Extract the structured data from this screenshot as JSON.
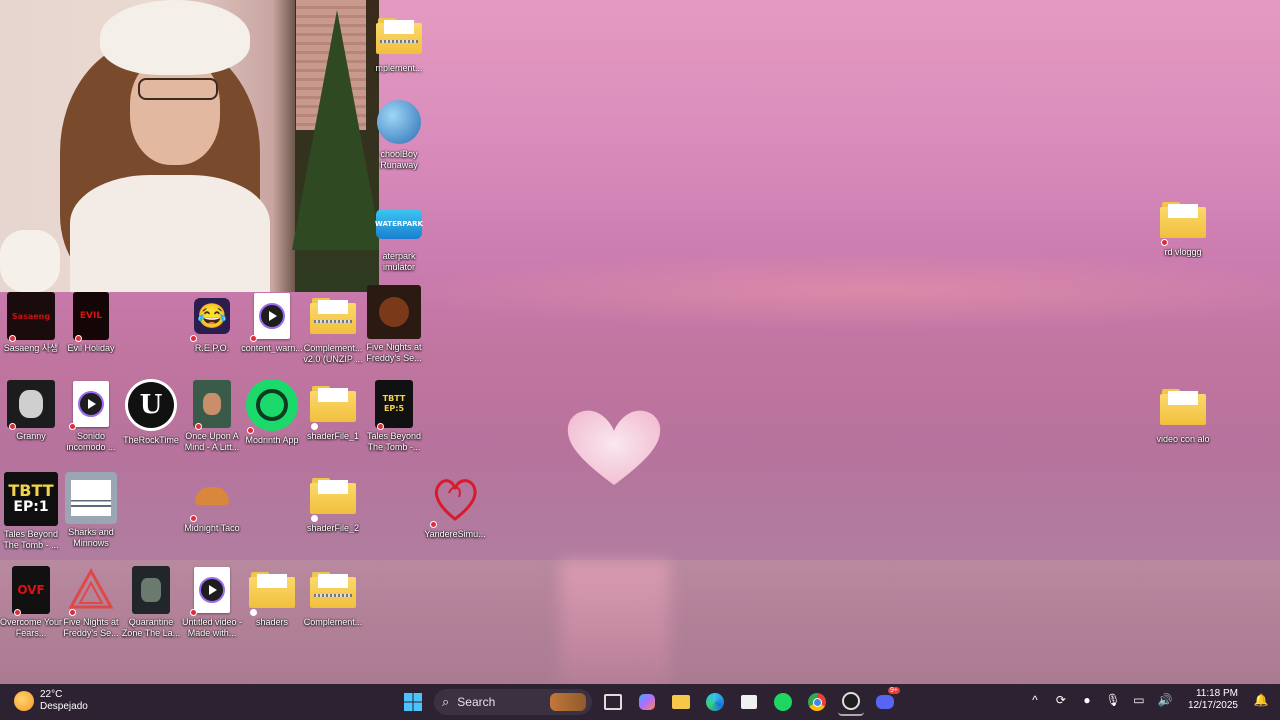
{
  "desktop": {
    "icons": [
      {
        "id": "complement-top",
        "label": "mplement..."
      },
      {
        "id": "schoolboy",
        "label": "choolBoy Runaway"
      },
      {
        "id": "waterpark",
        "label": "aterpark imulator"
      },
      {
        "id": "rd-vloggg",
        "label": "rd vloggg"
      },
      {
        "id": "video-con-alo",
        "label": "video con alo"
      },
      {
        "id": "sasaeng",
        "label": "Sasaeng 사생"
      },
      {
        "id": "evil-holiday",
        "label": "Evil Holiday"
      },
      {
        "id": "repo",
        "label": "R.E.P.O."
      },
      {
        "id": "content-warn",
        "label": "content_warn..."
      },
      {
        "id": "complement-v2",
        "label": "Complement... v2.0 (UNZIP ..."
      },
      {
        "id": "fnaf-se-1",
        "label": "Five Nights at Freddy's Se..."
      },
      {
        "id": "granny",
        "label": "Granny"
      },
      {
        "id": "sonido",
        "label": "Sonido incomodo ..."
      },
      {
        "id": "therocktime",
        "label": "TheRockTime"
      },
      {
        "id": "once-upon",
        "label": "Once Upon A Mind - A Litt..."
      },
      {
        "id": "modrinth",
        "label": "Modrinth App"
      },
      {
        "id": "shaderfile-1",
        "label": "shaderFile_1"
      },
      {
        "id": "tales-tomb-1",
        "label": "Tales Beyond The Tomb -..."
      },
      {
        "id": "tales-tomb-2",
        "label": "Tales Beyond The Tomb - ..."
      },
      {
        "id": "sharks",
        "label": "Sharks and Minnows"
      },
      {
        "id": "midnight-taco",
        "label": "Midnight Taco"
      },
      {
        "id": "shaderfile-2",
        "label": "shaderFile_2"
      },
      {
        "id": "yandere",
        "label": "YandereSimu..."
      },
      {
        "id": "overcome",
        "label": "Overcome Your Fears..."
      },
      {
        "id": "fnaf-se-2",
        "label": "Five Nights at Freddy's Se..."
      },
      {
        "id": "quarantine",
        "label": "Quarantine Zone The La..."
      },
      {
        "id": "untitled-video",
        "label": "Untitled video - Made with..."
      },
      {
        "id": "shaders",
        "label": "shaders"
      },
      {
        "id": "complement-bottom",
        "label": "Complement..."
      }
    ],
    "glyphs": {
      "tbtt_small": "TBTT EP:5",
      "tbtt_big": "TBTT",
      "tbtt_ep": "EP:1",
      "ovf": "OVF",
      "evil": "EVIL",
      "sasaeng_art": "Sasaeng",
      "waterpark_art": "WATERPARK"
    }
  },
  "taskbar": {
    "weather_temp": "22°C",
    "weather_desc": "Despejado",
    "search_label": "Search",
    "time": "11:18 PM",
    "date": "12/17/2025",
    "discord_badge": "9+"
  },
  "colors": {
    "taskbar_bg": "#2c2231",
    "folder": "#f5c84a"
  }
}
